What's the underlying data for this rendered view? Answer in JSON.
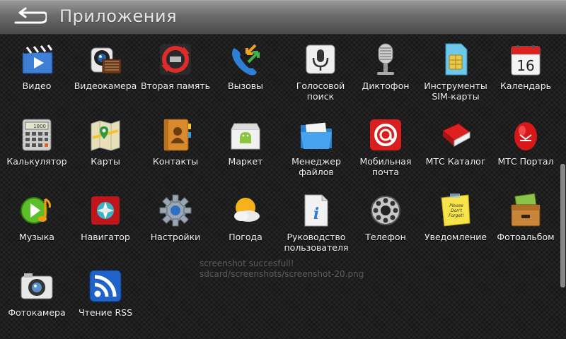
{
  "header": {
    "title": "Приложения"
  },
  "apps": [
    {
      "label": "Видео",
      "icon": "video-clapper-icon"
    },
    {
      "label": "Видеокамера",
      "icon": "camcorder-icon"
    },
    {
      "label": "Вторая память",
      "icon": "second-memory-icon"
    },
    {
      "label": "Вызовы",
      "icon": "calls-icon"
    },
    {
      "label": "Голосовой\nпоиск",
      "icon": "microphone-icon"
    },
    {
      "label": "Диктофон",
      "icon": "studio-microphone-icon"
    },
    {
      "label": "Инструменты\nSIM-карты",
      "icon": "sim-card-icon"
    },
    {
      "label": "Календарь",
      "icon": "calendar-icon",
      "badge": "16"
    },
    {
      "label": "Калькулятор",
      "icon": "calculator-icon",
      "badge": "1800"
    },
    {
      "label": "Карты",
      "icon": "map-icon"
    },
    {
      "label": "Контакты",
      "icon": "contacts-book-icon"
    },
    {
      "label": "Маркет",
      "icon": "market-bag-icon"
    },
    {
      "label": "Менеджер\nфайлов",
      "icon": "folder-icon"
    },
    {
      "label": "Мобильная\nпочта",
      "icon": "mobile-mail-icon"
    },
    {
      "label": "МТС Каталог",
      "icon": "mts-catalog-book-icon"
    },
    {
      "label": "МТС Портал",
      "icon": "mts-portal-egg-icon"
    },
    {
      "label": "Музыка",
      "icon": "music-play-icon"
    },
    {
      "label": "Навигатор",
      "icon": "navigator-compass-icon"
    },
    {
      "label": "Настройки",
      "icon": "gear-icon"
    },
    {
      "label": "Погода",
      "icon": "weather-sun-cloud-icon"
    },
    {
      "label": "Руководство\nпользователя",
      "icon": "user-guide-info-icon"
    },
    {
      "label": "Телефон",
      "icon": "rotary-phone-icon"
    },
    {
      "label": "Уведомление",
      "icon": "sticky-note-icon",
      "badge": "Please Don't Forget!"
    },
    {
      "label": "Фотоальбом",
      "icon": "photo-album-box-icon"
    },
    {
      "label": "Фотокамера",
      "icon": "photo-camera-icon"
    },
    {
      "label": "Чтение RSS",
      "icon": "rss-icon"
    }
  ],
  "toast": {
    "text": "screenshot succesfull!\nsdcard/screenshots/screenshot-20.png"
  },
  "colors": {
    "background": "#1e1e1e",
    "header": "#6c6c6c",
    "label": "#f2f2f2"
  }
}
